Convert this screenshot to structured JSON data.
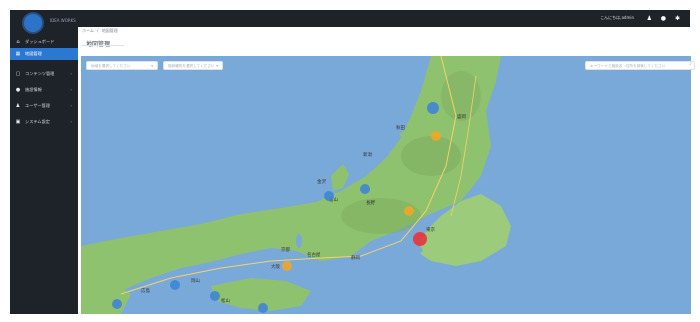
{
  "app": {
    "logo_text": "IDEA WORKS",
    "username": "こんにちは,admin"
  },
  "sidebar": {
    "items": [
      {
        "label": "ダッシュボード",
        "icon": "home-icon",
        "active": false,
        "has_chevron": false
      },
      {
        "label": "地図管理",
        "icon": "map-icon",
        "active": true,
        "has_chevron": false
      },
      {
        "label": "コンテンツ管理",
        "icon": "content-icon",
        "active": false,
        "has_chevron": true
      },
      {
        "label": "施設情報",
        "icon": "location-icon",
        "active": false,
        "has_chevron": true
      },
      {
        "label": "ユーザー管理",
        "icon": "user-icon",
        "active": false,
        "has_chevron": true
      },
      {
        "label": "システム設定",
        "icon": "settings-icon",
        "active": false,
        "has_chevron": true
      }
    ]
  },
  "breadcrumb": {
    "home": "ホーム",
    "sep": "/",
    "current": "地図管理"
  },
  "page": {
    "title": "地図管理"
  },
  "filters": {
    "select1": "地域を選択してください",
    "select2": "施設種別を選択してください",
    "search_placeholder": "キーワードで施設名・住所を検索してください"
  },
  "map": {
    "labels": [
      "秋田",
      "盛岡",
      "新潟",
      "金沢",
      "富山",
      "長野",
      "東京",
      "名古屋",
      "大阪",
      "京都",
      "静岡",
      "広島",
      "岡山",
      "松山"
    ],
    "markers": [
      {
        "name": "marker-tohoku",
        "color": "#3b82d8"
      },
      {
        "name": "marker-sendai",
        "color": "#f5a623"
      },
      {
        "name": "marker-niigata",
        "color": "#3b82d8"
      },
      {
        "name": "marker-kanazawa",
        "color": "#3b82d8"
      },
      {
        "name": "marker-kanto",
        "color": "#f5a623"
      },
      {
        "name": "marker-tokyo",
        "color": "#e8343a"
      },
      {
        "name": "marker-nagoya",
        "color": "#f5a623"
      },
      {
        "name": "marker-okayama",
        "color": "#3b82d8"
      },
      {
        "name": "marker-hiroshima",
        "color": "#3b82d8"
      },
      {
        "name": "marker-shikoku",
        "color": "#3b82d8"
      },
      {
        "name": "marker-fukuoka",
        "color": "#3b82d8"
      }
    ],
    "water_color": "#79a9d8",
    "land_color": "#8fc26e"
  }
}
